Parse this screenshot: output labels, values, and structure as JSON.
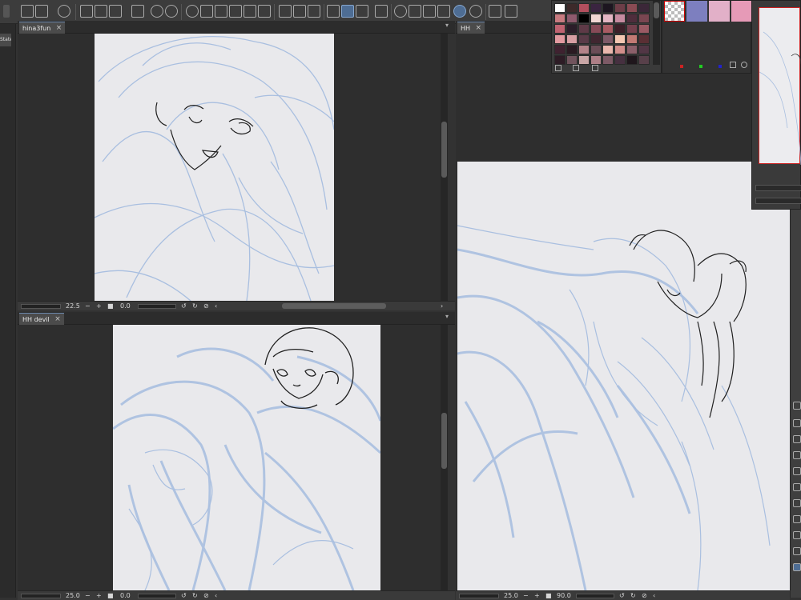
{
  "windows": {
    "top_left": {
      "tab": "hina3fun",
      "zoom": "22.5",
      "rotation": "0.0"
    },
    "bottom_left": {
      "tab": "HH devil",
      "zoom": "25.0",
      "rotation": "0.0"
    },
    "right": {
      "tab": "HH",
      "zoom": "25.0",
      "rotation": "90.0"
    }
  },
  "left_panel": {
    "label": "State"
  },
  "icons": [
    "menu-icon",
    "layer-property-icon",
    "spiral-icon",
    "new-file-icon",
    "open-icon",
    "print-icon",
    "undo-icon",
    "redo-icon",
    "loading-icon",
    "transform-icon",
    "fill-icon",
    "select-icon",
    "brush-icon",
    "ruler-icon",
    "magic-wand-icon",
    "folder-icon"
  ],
  "colors": {
    "accent": "#6c88ad",
    "paper": "#e9e9ec",
    "sketch_blue": "#a9bfe0",
    "line_art": "#202020"
  },
  "palette": [
    "#fff",
    "#3d2a2a",
    "#b34f5e",
    "#3a2440",
    "#1d1620",
    "#6d3e48",
    "#8a4b53",
    "#3b2738",
    "#c87b80",
    "#8e5a6d",
    "#000",
    "#f2d7d4",
    "#e3b6c3",
    "#c68ba0",
    "#4f2d3c",
    "#7a4651",
    "#c06371",
    "#2b1d29",
    "#5e3a47",
    "#874a57",
    "#a95b63",
    "#3c1f28",
    "#74404d",
    "#9b5a64",
    "#e29aa0",
    "#d79fa3",
    "#5a3b48",
    "#402630",
    "#7e5a68",
    "#f4c7b2",
    "#c27a74",
    "#5a2f34",
    "#3f2230",
    "#2a1b22",
    "#b48389",
    "#6b4d57",
    "#eab7ad",
    "#d28e8b",
    "#8b5f6a",
    "#523645",
    "#2d1c25",
    "#71545d",
    "#c9a6a6",
    "#ae7f87",
    "#7d5a66",
    "#463040",
    "#1f161c",
    "#58404a"
  ],
  "subcolors": [
    "#7d7fbf",
    "#e2b0c8",
    "#e69ab7"
  ]
}
